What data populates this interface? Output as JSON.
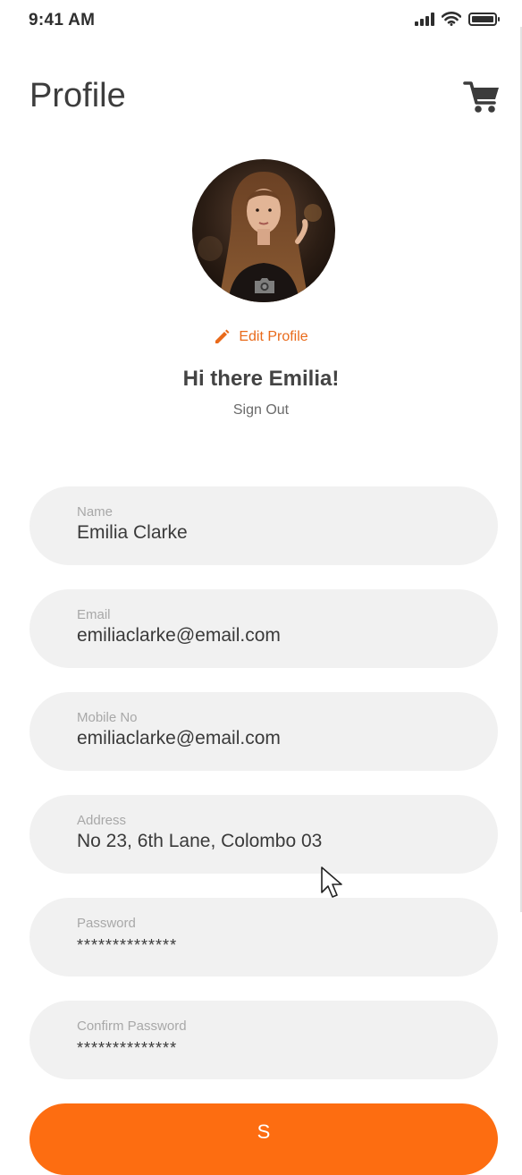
{
  "status_bar": {
    "time": "9:41 AM"
  },
  "header": {
    "title": "Profile",
    "cart_icon": "shopping-cart-icon"
  },
  "profile": {
    "avatar_icon": "camera-icon",
    "edit_label": "Edit Profile",
    "greeting": "Hi there Emilia!",
    "sign_out_label": "Sign Out"
  },
  "form": {
    "fields": [
      {
        "label": "Name",
        "value": "Emilia Clarke"
      },
      {
        "label": "Email",
        "value": "emiliaclarke@email.com"
      },
      {
        "label": "Mobile No",
        "value": "emiliaclarke@email.com"
      },
      {
        "label": "Address",
        "value": "No 23, 6th Lane, Colombo 03"
      },
      {
        "label": "Password",
        "value": "**************"
      },
      {
        "label": "Confirm Password",
        "value": "**************"
      }
    ],
    "save_label": "S"
  },
  "colors": {
    "accent": "#fd6d11",
    "edit_link": "#e96a1a",
    "field_bg": "#f1f1f1"
  }
}
